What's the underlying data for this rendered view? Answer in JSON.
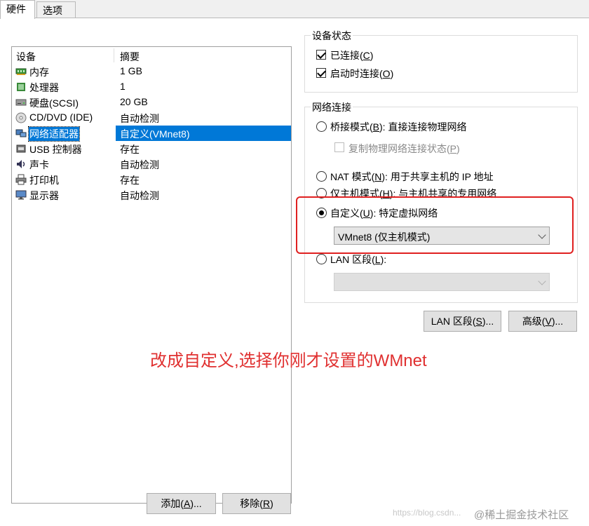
{
  "tabs": [
    "硬件",
    "选项"
  ],
  "device_list": {
    "headers": [
      "设备",
      "摘要"
    ],
    "rows": [
      {
        "icon": "memory-icon",
        "name": "内存",
        "summary": "1 GB"
      },
      {
        "icon": "processor-icon",
        "name": "处理器",
        "summary": "1"
      },
      {
        "icon": "harddisk-icon",
        "name": "硬盘(SCSI)",
        "summary": "20 GB"
      },
      {
        "icon": "cd-dvd-icon",
        "name": "CD/DVD (IDE)",
        "summary": "自动检测"
      },
      {
        "icon": "network-adapter-icon",
        "name": "网络适配器",
        "summary": "自定义(VMnet8)"
      },
      {
        "icon": "usb-controller-icon",
        "name": "USB 控制器",
        "summary": "存在"
      },
      {
        "icon": "sound-card-icon",
        "name": "声卡",
        "summary": "自动检测"
      },
      {
        "icon": "printer-icon",
        "name": "打印机",
        "summary": "存在"
      },
      {
        "icon": "display-icon",
        "name": "显示器",
        "summary": "自动检测"
      }
    ],
    "selected_index": 4
  },
  "buttons": {
    "add": "添加(A)...",
    "remove": "移除(R)",
    "lan_segments": "LAN 区段(S)...",
    "advanced": "高级(V)..."
  },
  "device_status": {
    "label": "设备状态",
    "connected": {
      "label_pre": "已连接(",
      "key": "C",
      "label_post": ")",
      "checked": true
    },
    "connect_at_power_on": {
      "label_pre": "启动时连接(",
      "key": "O",
      "label_post": ")",
      "checked": true
    }
  },
  "network_connection": {
    "label": "网络连接",
    "bridged": {
      "label_pre": "桥接模式(",
      "key": "B",
      "label_post": "): 直接连接物理网络"
    },
    "replicate": {
      "label_pre": "复制物理网络连接状态(",
      "key": "P",
      "label_post": ")"
    },
    "nat": {
      "label_pre": "NAT 模式(",
      "key": "N",
      "label_post": "): 用于共享主机的 IP 地址"
    },
    "host_only": {
      "label_pre": "仅主机模式(",
      "key": "H",
      "label_post": "): 与主机共享的专用网络"
    },
    "custom": {
      "label_pre": "自定义(",
      "key": "U",
      "label_post": "): 特定虚拟网络"
    },
    "custom_select": "VMnet8 (仅主机模式)",
    "lan_segment": {
      "label_pre": "LAN 区段(",
      "key": "L",
      "label_post": "):"
    },
    "selected": "custom"
  },
  "annotation": "改成自定义,选择你刚才设置的WMnet",
  "watermark": "https://blog.csdn...",
  "watermark2": "@稀土掘金技术社区",
  "colors": {
    "selection": "#0078d7",
    "annotation": "#e03030"
  }
}
